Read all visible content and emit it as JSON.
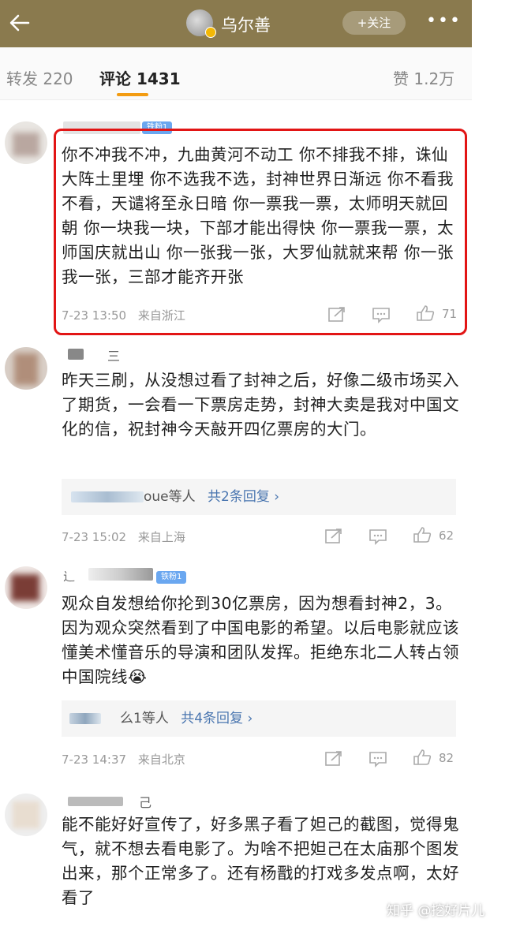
{
  "header": {
    "title": "乌尔善",
    "follow_label": "+关注",
    "more_label": "•••"
  },
  "tabs": [
    {
      "label": "转发 220"
    },
    {
      "label": "评论 1431"
    },
    {
      "label": "赞 1.2万"
    }
  ],
  "comments": [
    {
      "badge": "铁粉1",
      "text": "你不冲我不冲，九曲黄河不动工 你不排我不排，诛仙大阵土里埋 你不选我不选，封神世界日渐远 你不看我不看，天谴将至永日暗 你一票我一票，太师明天就回朝 你一块我一块，下部才能出得快 你一票我一票，太师国庆就出山 你一张我一张，大罗仙就就来帮 你一张我一张，三部才能齐开张",
      "time": "7-23 13:50",
      "location": "来自浙江",
      "likes": "71"
    },
    {
      "name_partial": "三",
      "text": "昨天三刷，从没想过看了封神之后，好像二级市场买入了期货，一会看一下票房走势，封神大卖是我对中国文化的信，祝封神今天敲开四亿票房的大门。",
      "reply_who": "oue等人",
      "reply_count": "共2条回复 ›",
      "time": "7-23 15:02",
      "location": "来自上海",
      "likes": "62"
    },
    {
      "name_partial": "辶",
      "badge": "铁粉1",
      "text": "观众自发想给你抡到30亿票房，因为想看封神2，3。因为观众突然看到了中国电影的希望。以后电影就应该懂美术懂音乐的导演和团队发挥。拒绝东北二人转占领中国院线😭",
      "reply_who": "么1等人",
      "reply_count": "共4条回复 ›",
      "time": "7-23 14:37",
      "location": "来自北京",
      "likes": "82"
    },
    {
      "name_partial": "己",
      "text": "能不能好好宣传了，好多黑子看了妲己的截图，觉得鬼气，就不想去看电影了。为啥不把妲己在太庙那个图发出来，那个正常多了。还有杨戬的打戏多发点啊，太好看了"
    }
  ],
  "watermark": "知乎 @挖好片儿",
  "colors": {
    "header_bg": "#8a7a4e",
    "highlight_border": "#e21515",
    "tab_indicator": "#f39c12",
    "link": "#4a76b0"
  }
}
